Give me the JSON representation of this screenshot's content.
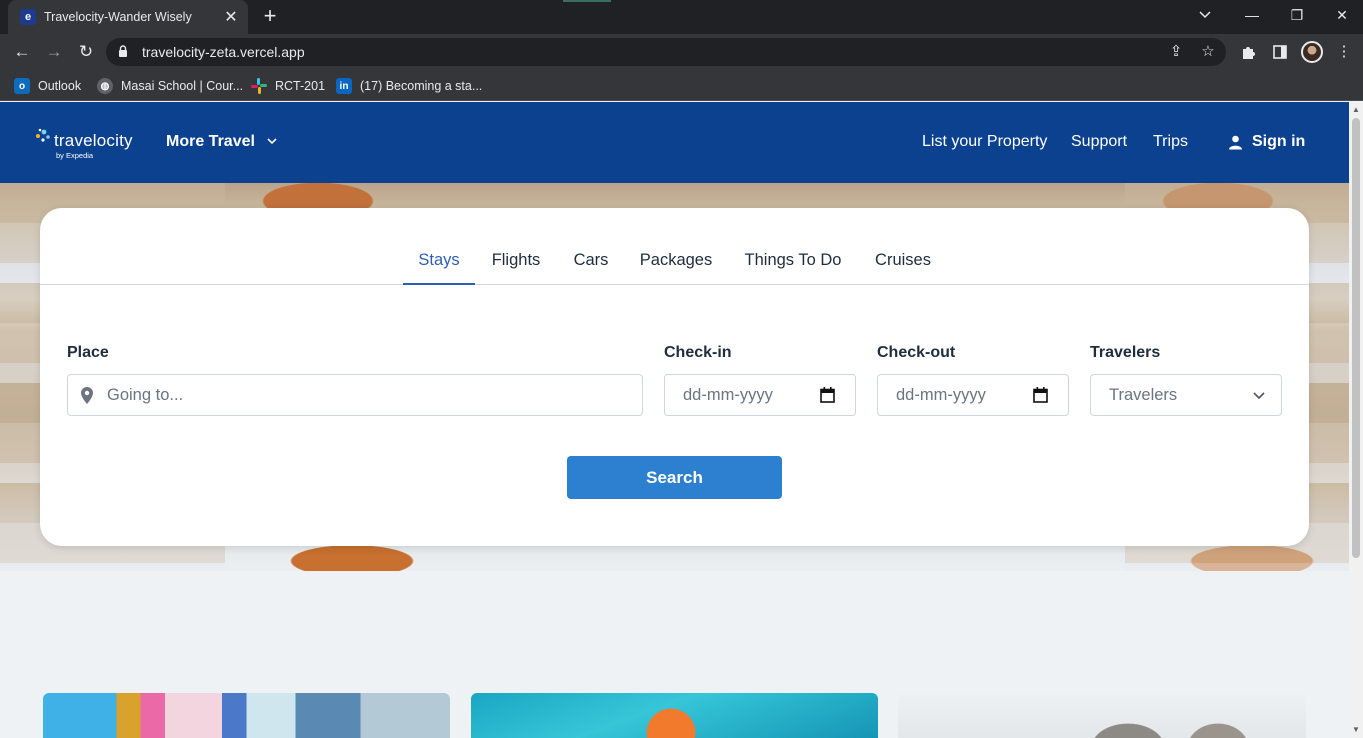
{
  "browser": {
    "tab_title": "Travelocity-Wander Wisely",
    "tab_close": "✕",
    "new_tab": "+",
    "url": "travelocity-zeta.vercel.app",
    "window_controls": {
      "minimize": "—",
      "restore": "❐",
      "close": "✕"
    },
    "bookmarks": [
      {
        "label": "Outlook",
        "icon": "outlook-icon",
        "color": "#0f6cbd"
      },
      {
        "label": "Masai School | Cour...",
        "icon": "globe-icon",
        "color": "#5f6368"
      },
      {
        "label": "RCT-201",
        "icon": "slack-icon",
        "color": "#e01e5a"
      },
      {
        "label": "(17) Becoming a sta...",
        "icon": "linkedin-icon",
        "color": "#0a66c2"
      }
    ]
  },
  "header": {
    "logo_text": "travelocity",
    "logo_sub": "by Expedia",
    "more_travel": "More Travel",
    "nav": [
      "List your Property",
      "Support",
      "Trips"
    ],
    "sign_in": "Sign in"
  },
  "search": {
    "tabs": [
      {
        "label": "Stays",
        "active": true
      },
      {
        "label": "Flights",
        "active": false
      },
      {
        "label": "Cars",
        "active": false
      },
      {
        "label": "Packages",
        "active": false
      },
      {
        "label": "Things To Do",
        "active": false
      },
      {
        "label": "Cruises",
        "active": false
      }
    ],
    "place_label": "Place",
    "place_placeholder": "Going to...",
    "checkin_label": "Check-in",
    "checkin_placeholder": "dd-mm-yyyy",
    "checkout_label": "Check-out",
    "checkout_placeholder": "dd-mm-yyyy",
    "travelers_label": "Travelers",
    "travelers_value": "Travelers",
    "button": "Search"
  },
  "colors": {
    "header_bg": "#0c4190",
    "search_button": "#2d7fd0",
    "active_tab": "#2c5fb3"
  }
}
